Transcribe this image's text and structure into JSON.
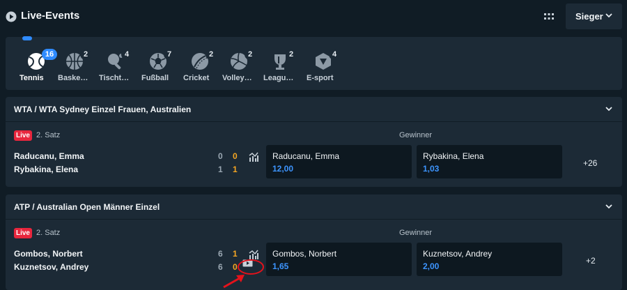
{
  "header": {
    "title": "Live-Events",
    "market_selector": "Sieger"
  },
  "sports": [
    {
      "label": "Tennis",
      "count": "16",
      "icon": "tennis-ball-icon",
      "active": true
    },
    {
      "label": "Baske…",
      "count": "2",
      "icon": "basketball-icon"
    },
    {
      "label": "Tischt…",
      "count": "4",
      "icon": "table-tennis-icon"
    },
    {
      "label": "Fußball",
      "count": "7",
      "icon": "football-icon"
    },
    {
      "label": "Cricket",
      "count": "2",
      "icon": "cricket-ball-icon"
    },
    {
      "label": "Volley…",
      "count": "2",
      "icon": "volleyball-icon"
    },
    {
      "label": "Leagu…",
      "count": "2",
      "icon": "league-trophy-icon"
    },
    {
      "label": "E-sport",
      "count": "4",
      "icon": "esport-icon"
    }
  ],
  "events": [
    {
      "competition": "WTA / WTA Sydney Einzel Frauen, Australien",
      "live_label": "Live",
      "period": "2. Satz",
      "market_label": "Gewinner",
      "players": [
        {
          "name": "Raducanu, Emma",
          "sets": "0",
          "games": "0"
        },
        {
          "name": "Rybakina, Elena",
          "sets": "1",
          "games": "1"
        }
      ],
      "odds": [
        {
          "name": "Raducanu, Emma",
          "value": "12,00"
        },
        {
          "name": "Rybakina, Elena",
          "value": "1,03"
        }
      ],
      "more_markets": "+26"
    },
    {
      "competition": "ATP / Australian Open Männer Einzel",
      "live_label": "Live",
      "period": "2. Satz",
      "market_label": "Gewinner",
      "players": [
        {
          "name": "Gombos, Norbert",
          "sets": "6",
          "games": "1"
        },
        {
          "name": "Kuznetsov, Andrey",
          "sets": "6",
          "games": "0"
        }
      ],
      "odds": [
        {
          "name": "Gombos, Norbert",
          "value": "1,65"
        },
        {
          "name": "Kuznetsov, Andrey",
          "value": "2,00"
        }
      ],
      "more_markets": "+2"
    }
  ],
  "colors": {
    "background": "#101c25",
    "panel": "#1c2a36",
    "accent": "#2f8bff",
    "live": "#e8263d",
    "score_games": "#f5a623",
    "odds_value": "#3d95ff",
    "annotation": "#e5121b"
  }
}
